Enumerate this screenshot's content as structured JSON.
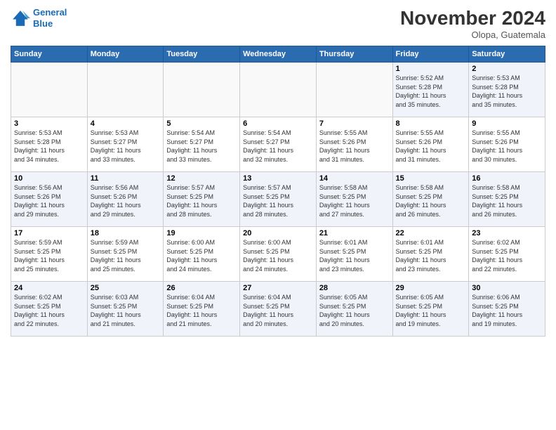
{
  "header": {
    "logo_line1": "General",
    "logo_line2": "Blue",
    "month_title": "November 2024",
    "location": "Olopa, Guatemala"
  },
  "weekdays": [
    "Sunday",
    "Monday",
    "Tuesday",
    "Wednesday",
    "Thursday",
    "Friday",
    "Saturday"
  ],
  "weeks": [
    [
      {
        "day": "",
        "info": ""
      },
      {
        "day": "",
        "info": ""
      },
      {
        "day": "",
        "info": ""
      },
      {
        "day": "",
        "info": ""
      },
      {
        "day": "",
        "info": ""
      },
      {
        "day": "1",
        "info": "Sunrise: 5:52 AM\nSunset: 5:28 PM\nDaylight: 11 hours\nand 35 minutes."
      },
      {
        "day": "2",
        "info": "Sunrise: 5:53 AM\nSunset: 5:28 PM\nDaylight: 11 hours\nand 35 minutes."
      }
    ],
    [
      {
        "day": "3",
        "info": "Sunrise: 5:53 AM\nSunset: 5:28 PM\nDaylight: 11 hours\nand 34 minutes."
      },
      {
        "day": "4",
        "info": "Sunrise: 5:53 AM\nSunset: 5:27 PM\nDaylight: 11 hours\nand 33 minutes."
      },
      {
        "day": "5",
        "info": "Sunrise: 5:54 AM\nSunset: 5:27 PM\nDaylight: 11 hours\nand 33 minutes."
      },
      {
        "day": "6",
        "info": "Sunrise: 5:54 AM\nSunset: 5:27 PM\nDaylight: 11 hours\nand 32 minutes."
      },
      {
        "day": "7",
        "info": "Sunrise: 5:55 AM\nSunset: 5:26 PM\nDaylight: 11 hours\nand 31 minutes."
      },
      {
        "day": "8",
        "info": "Sunrise: 5:55 AM\nSunset: 5:26 PM\nDaylight: 11 hours\nand 31 minutes."
      },
      {
        "day": "9",
        "info": "Sunrise: 5:55 AM\nSunset: 5:26 PM\nDaylight: 11 hours\nand 30 minutes."
      }
    ],
    [
      {
        "day": "10",
        "info": "Sunrise: 5:56 AM\nSunset: 5:26 PM\nDaylight: 11 hours\nand 29 minutes."
      },
      {
        "day": "11",
        "info": "Sunrise: 5:56 AM\nSunset: 5:26 PM\nDaylight: 11 hours\nand 29 minutes."
      },
      {
        "day": "12",
        "info": "Sunrise: 5:57 AM\nSunset: 5:25 PM\nDaylight: 11 hours\nand 28 minutes."
      },
      {
        "day": "13",
        "info": "Sunrise: 5:57 AM\nSunset: 5:25 PM\nDaylight: 11 hours\nand 28 minutes."
      },
      {
        "day": "14",
        "info": "Sunrise: 5:58 AM\nSunset: 5:25 PM\nDaylight: 11 hours\nand 27 minutes."
      },
      {
        "day": "15",
        "info": "Sunrise: 5:58 AM\nSunset: 5:25 PM\nDaylight: 11 hours\nand 26 minutes."
      },
      {
        "day": "16",
        "info": "Sunrise: 5:58 AM\nSunset: 5:25 PM\nDaylight: 11 hours\nand 26 minutes."
      }
    ],
    [
      {
        "day": "17",
        "info": "Sunrise: 5:59 AM\nSunset: 5:25 PM\nDaylight: 11 hours\nand 25 minutes."
      },
      {
        "day": "18",
        "info": "Sunrise: 5:59 AM\nSunset: 5:25 PM\nDaylight: 11 hours\nand 25 minutes."
      },
      {
        "day": "19",
        "info": "Sunrise: 6:00 AM\nSunset: 5:25 PM\nDaylight: 11 hours\nand 24 minutes."
      },
      {
        "day": "20",
        "info": "Sunrise: 6:00 AM\nSunset: 5:25 PM\nDaylight: 11 hours\nand 24 minutes."
      },
      {
        "day": "21",
        "info": "Sunrise: 6:01 AM\nSunset: 5:25 PM\nDaylight: 11 hours\nand 23 minutes."
      },
      {
        "day": "22",
        "info": "Sunrise: 6:01 AM\nSunset: 5:25 PM\nDaylight: 11 hours\nand 23 minutes."
      },
      {
        "day": "23",
        "info": "Sunrise: 6:02 AM\nSunset: 5:25 PM\nDaylight: 11 hours\nand 22 minutes."
      }
    ],
    [
      {
        "day": "24",
        "info": "Sunrise: 6:02 AM\nSunset: 5:25 PM\nDaylight: 11 hours\nand 22 minutes."
      },
      {
        "day": "25",
        "info": "Sunrise: 6:03 AM\nSunset: 5:25 PM\nDaylight: 11 hours\nand 21 minutes."
      },
      {
        "day": "26",
        "info": "Sunrise: 6:04 AM\nSunset: 5:25 PM\nDaylight: 11 hours\nand 21 minutes."
      },
      {
        "day": "27",
        "info": "Sunrise: 6:04 AM\nSunset: 5:25 PM\nDaylight: 11 hours\nand 20 minutes."
      },
      {
        "day": "28",
        "info": "Sunrise: 6:05 AM\nSunset: 5:25 PM\nDaylight: 11 hours\nand 20 minutes."
      },
      {
        "day": "29",
        "info": "Sunrise: 6:05 AM\nSunset: 5:25 PM\nDaylight: 11 hours\nand 19 minutes."
      },
      {
        "day": "30",
        "info": "Sunrise: 6:06 AM\nSunset: 5:25 PM\nDaylight: 11 hours\nand 19 minutes."
      }
    ]
  ]
}
